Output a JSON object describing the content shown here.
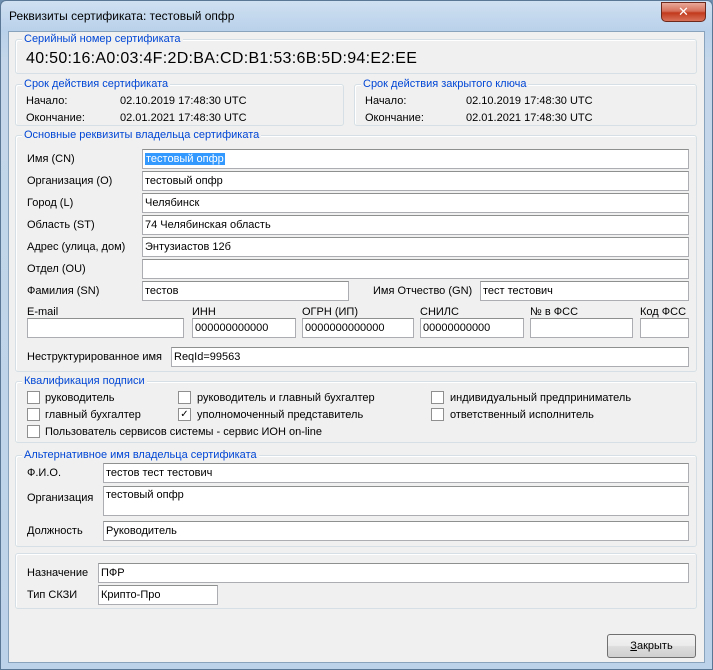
{
  "window": {
    "title": "Реквизиты сертификата: тестовый опфр",
    "close_glyph": "✕"
  },
  "serial": {
    "title": "Серийный номер сертификата",
    "value": "40:50:16:A0:03:4F:2D:BA:CD:B1:53:6B:5D:94:E2:EE"
  },
  "cert_validity": {
    "title": "Срок действия сертификата",
    "start_label": "Начало:",
    "start_value": "02.10.2019 17:48:30 UTC",
    "end_label": "Окончание:",
    "end_value": "02.01.2021 17:48:30 UTC"
  },
  "key_validity": {
    "title": "Срок действия закрытого ключа",
    "start_label": "Начало:",
    "start_value": "02.10.2019 17:48:30 UTC",
    "end_label": "Окончание:",
    "end_value": "02.01.2021 17:48:30 UTC"
  },
  "owner": {
    "title": "Основные реквизиты владельца сертификата",
    "cn_label": "Имя (CN)",
    "cn_value": "тестовый опфр",
    "org_label": "Организация (O)",
    "org_value": "тестовый опфр",
    "city_label": "Город (L)",
    "city_value": "Челябинск",
    "region_label": "Область (ST)",
    "region_value": "74 Челябинская область",
    "address_label": "Адрес   (улица, дом)",
    "address_value": "Энтузиастов 12б",
    "dept_label": "Отдел (OU)",
    "dept_value": "",
    "surname_label": "Фамилия (SN)",
    "surname_value": "тестов",
    "given_label": "Имя Отчество (GN)",
    "given_value": "тест тестович",
    "email_label": "E-mail",
    "email_value": "",
    "inn_label": "ИНН",
    "inn_value": "000000000000",
    "ogrn_label": "ОГРН (ИП)",
    "ogrn_value": "0000000000000",
    "snils_label": "СНИЛС",
    "snils_value": "00000000000",
    "fss_no_label": "№ в ФСС",
    "fss_no_value": "",
    "fss_code_label": "Код ФСС",
    "fss_code_value": "",
    "unstructured_label": "Неструктурированное имя",
    "unstructured_value": "ReqId=99563"
  },
  "qualification": {
    "title": "Квалификация подписи",
    "items": [
      {
        "label": "руководитель",
        "checked": false
      },
      {
        "label": "главный бухгалтер",
        "checked": false
      },
      {
        "label": "руководитель и главный бухгалтер",
        "checked": false
      },
      {
        "label": "уполномоченный представитель",
        "checked": true
      },
      {
        "label": "индивидуальный предприниматель",
        "checked": false
      },
      {
        "label": "ответственный исполнитель",
        "checked": false
      },
      {
        "label": "Пользователь сервисов системы - сервис ИОН on-line",
        "checked": false
      }
    ],
    "check_glyph": "✓"
  },
  "alt_owner": {
    "title": "Альтернативное имя владельца сертификата",
    "fio_label": "Ф.И.О.",
    "fio_value": "тестов тест тестович",
    "org_label": "Организация",
    "org_value": "тестовый опфр",
    "position_label": "Должность",
    "position_value": "Руководитель"
  },
  "purpose": {
    "purpose_label": "Назначение",
    "purpose_value": "ПФР",
    "skzi_label": "Тип СКЗИ",
    "skzi_value": "Крипто-Про"
  },
  "buttons": {
    "close_label_first": "З",
    "close_label_rest": "акрыть"
  }
}
